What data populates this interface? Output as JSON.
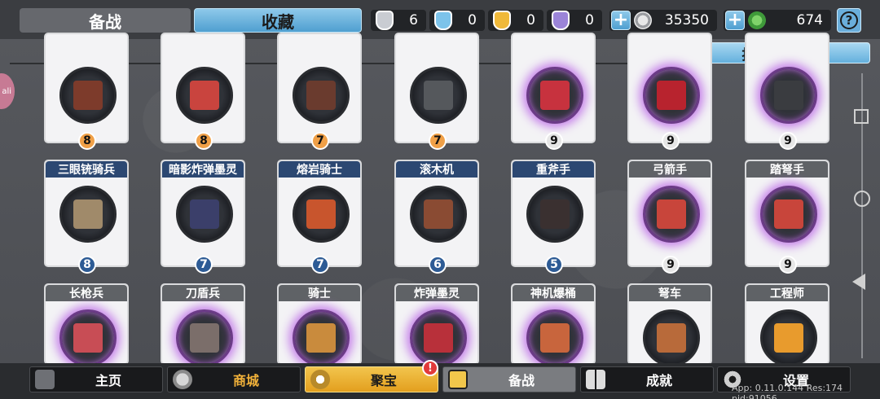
{
  "tabs": {
    "prep": "备战",
    "collection": "收藏"
  },
  "resources": [
    {
      "name": "silver-shield-icon",
      "value": "6",
      "color": "#c9ccd2"
    },
    {
      "name": "blue-shield-icon",
      "value": "0",
      "color": "#7cc3ea"
    },
    {
      "name": "gold-shield-icon",
      "value": "0",
      "color": "#f0b93a"
    },
    {
      "name": "purple-shield-icon",
      "value": "0",
      "color": "#9b84d8"
    }
  ],
  "silver_coins": "35350",
  "green_coins": "674",
  "help_label": "?",
  "sort_label": "按战绩排序",
  "side_bubble": "ali",
  "cards": [
    {
      "name": "",
      "level": "8",
      "level_style": "orange",
      "glow": false,
      "face": "#7d3b2b"
    },
    {
      "name": "",
      "level": "8",
      "level_style": "orange",
      "glow": false,
      "face": "#c9443e"
    },
    {
      "name": "",
      "level": "7",
      "level_style": "orange",
      "glow": false,
      "face": "#6a3b2e"
    },
    {
      "name": "",
      "level": "7",
      "level_style": "orange",
      "glow": false,
      "face": "#55585c"
    },
    {
      "name": "",
      "level": "9",
      "level_style": "gray",
      "glow": true,
      "face": "#c7323e"
    },
    {
      "name": "",
      "level": "9",
      "level_style": "gray",
      "glow": true,
      "face": "#b8232e"
    },
    {
      "name": "",
      "level": "9",
      "level_style": "gray",
      "glow": true,
      "face": "#3a3c40"
    },
    {
      "name": "三眼铳骑兵",
      "level": "8",
      "level_style": "blue",
      "glow": false,
      "face": "#a08a6a",
      "header": "blue"
    },
    {
      "name": "暗影炸弹墨灵",
      "level": "7",
      "level_style": "blue",
      "glow": false,
      "face": "#3b3f6a",
      "header": "blue"
    },
    {
      "name": "熔岩骑士",
      "level": "7",
      "level_style": "blue",
      "glow": false,
      "face": "#c8552d",
      "header": "blue"
    },
    {
      "name": "滚木机",
      "level": "6",
      "level_style": "blue",
      "glow": false,
      "face": "#8a4b33",
      "header": "blue"
    },
    {
      "name": "重斧手",
      "level": "5",
      "level_style": "blue",
      "glow": false,
      "face": "#3a3030",
      "header": "blue"
    },
    {
      "name": "弓箭手",
      "level": "9",
      "level_style": "gray",
      "glow": true,
      "face": "#c8453b",
      "header": "gray"
    },
    {
      "name": "踏弩手",
      "level": "9",
      "level_style": "gray",
      "glow": true,
      "face": "#c8453b",
      "header": "gray"
    },
    {
      "name": "长枪兵",
      "level": "",
      "level_style": "gray",
      "glow": true,
      "face": "#c84d55",
      "header": "gray"
    },
    {
      "name": "刀盾兵",
      "level": "",
      "level_style": "gray",
      "glow": true,
      "face": "#7b6e6a",
      "header": "gray"
    },
    {
      "name": "骑士",
      "level": "",
      "level_style": "gray",
      "glow": true,
      "face": "#c98b3d",
      "header": "gray"
    },
    {
      "name": "炸弹墨灵",
      "level": "",
      "level_style": "gray",
      "glow": true,
      "face": "#b8303a",
      "header": "gray"
    },
    {
      "name": "神机爆桶",
      "level": "",
      "level_style": "gray",
      "glow": true,
      "face": "#c8653d",
      "header": "gray"
    },
    {
      "name": "弩车",
      "level": "",
      "level_style": "gray",
      "glow": false,
      "face": "#b86a3a",
      "header": "gray"
    },
    {
      "name": "工程师",
      "level": "",
      "level_style": "gray",
      "glow": false,
      "face": "#e89b2d",
      "header": "gray"
    }
  ],
  "bottom_nav": [
    {
      "label": "主页",
      "icon": "home-gate-icon",
      "style": "dark"
    },
    {
      "label": "商城",
      "icon": "coins-icon",
      "style": "dark",
      "color": "#f2b23a"
    },
    {
      "label": "聚宝",
      "icon": "treasure-bowl-icon",
      "style": "gold"
    },
    {
      "label": "备战",
      "icon": "cards-icon",
      "style": "gray"
    },
    {
      "label": "成就",
      "icon": "achievement-grid-icon",
      "style": "dark"
    },
    {
      "label": "设置",
      "icon": "gear-icon",
      "style": "dark"
    }
  ],
  "alert_badge": "!",
  "version": "App: 0.11.0.144 Res:174 pid:91056"
}
